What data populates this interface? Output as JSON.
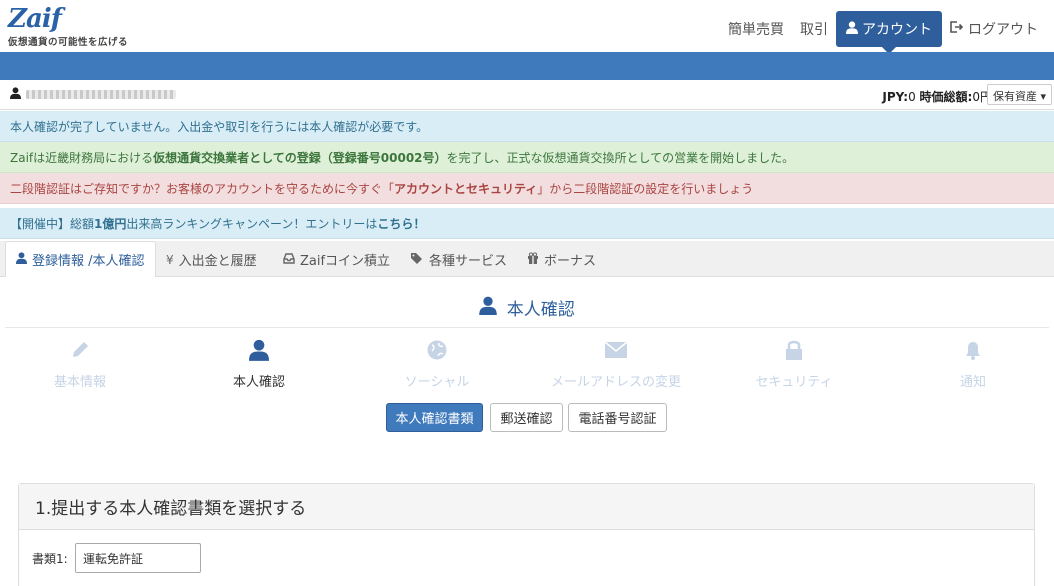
{
  "header": {
    "logo_text": "Zaif",
    "tagline": "仮想通貨の可能性を広げる",
    "nav": {
      "simple_trade": "簡単売買",
      "trade": "取引",
      "account": "アカウント",
      "logout": "ログアウト"
    }
  },
  "userbar": {
    "jpy_label": "JPY:",
    "jpy_value": "0",
    "total_label": "時価総額:",
    "total_value": "0円",
    "holdings_label": "保有資産"
  },
  "alerts": {
    "kyc": "本人確認が完了していません。入出金や取引を行うには本人確認が必要です。",
    "reg_pre": "Zaifは近畿財務局における",
    "reg_bold": "仮想通貨交換業者としての登録（登録番号00002号）",
    "reg_post": "を完了し、正式な仮想通貨交換所としての営業を開始しました。",
    "twofa_pre": "二段階認証はご存知ですか？お客様のアカウントを守るために今すぐ「",
    "twofa_bold": "アカウントとセキュリティ",
    "twofa_post": "」から二段階認証の設定を行いましょう",
    "campaign_pre": "【開催中】総額",
    "campaign_bold1": "1億円",
    "campaign_mid": "出来高ランキングキャンペーン！エントリーは",
    "campaign_bold2": "こちら！"
  },
  "tabs": {
    "registration": "登録情報 /本人確認",
    "deposit": "入出金と履歴",
    "zaif_coin": "Zaifコイン積立",
    "services": "各種サービス",
    "bonus": "ボーナス"
  },
  "main": {
    "title": "本人確認",
    "steps": {
      "basic": "基本情報",
      "identity": "本人確認",
      "social": "ソーシャル",
      "email": "メールアドレスの変更",
      "security": "セキュリティ",
      "notify": "通知"
    },
    "buttons": {
      "documents": "本人確認書類",
      "postal": "郵送確認",
      "phone": "電話番号認証"
    },
    "panel": {
      "heading": "1.提出する本人確認書類を選択する",
      "doc_label": "書類1:",
      "doc_value": "運転免許証"
    }
  },
  "colors": {
    "brand": "#2e5f9c",
    "bar": "#3f7abd"
  }
}
